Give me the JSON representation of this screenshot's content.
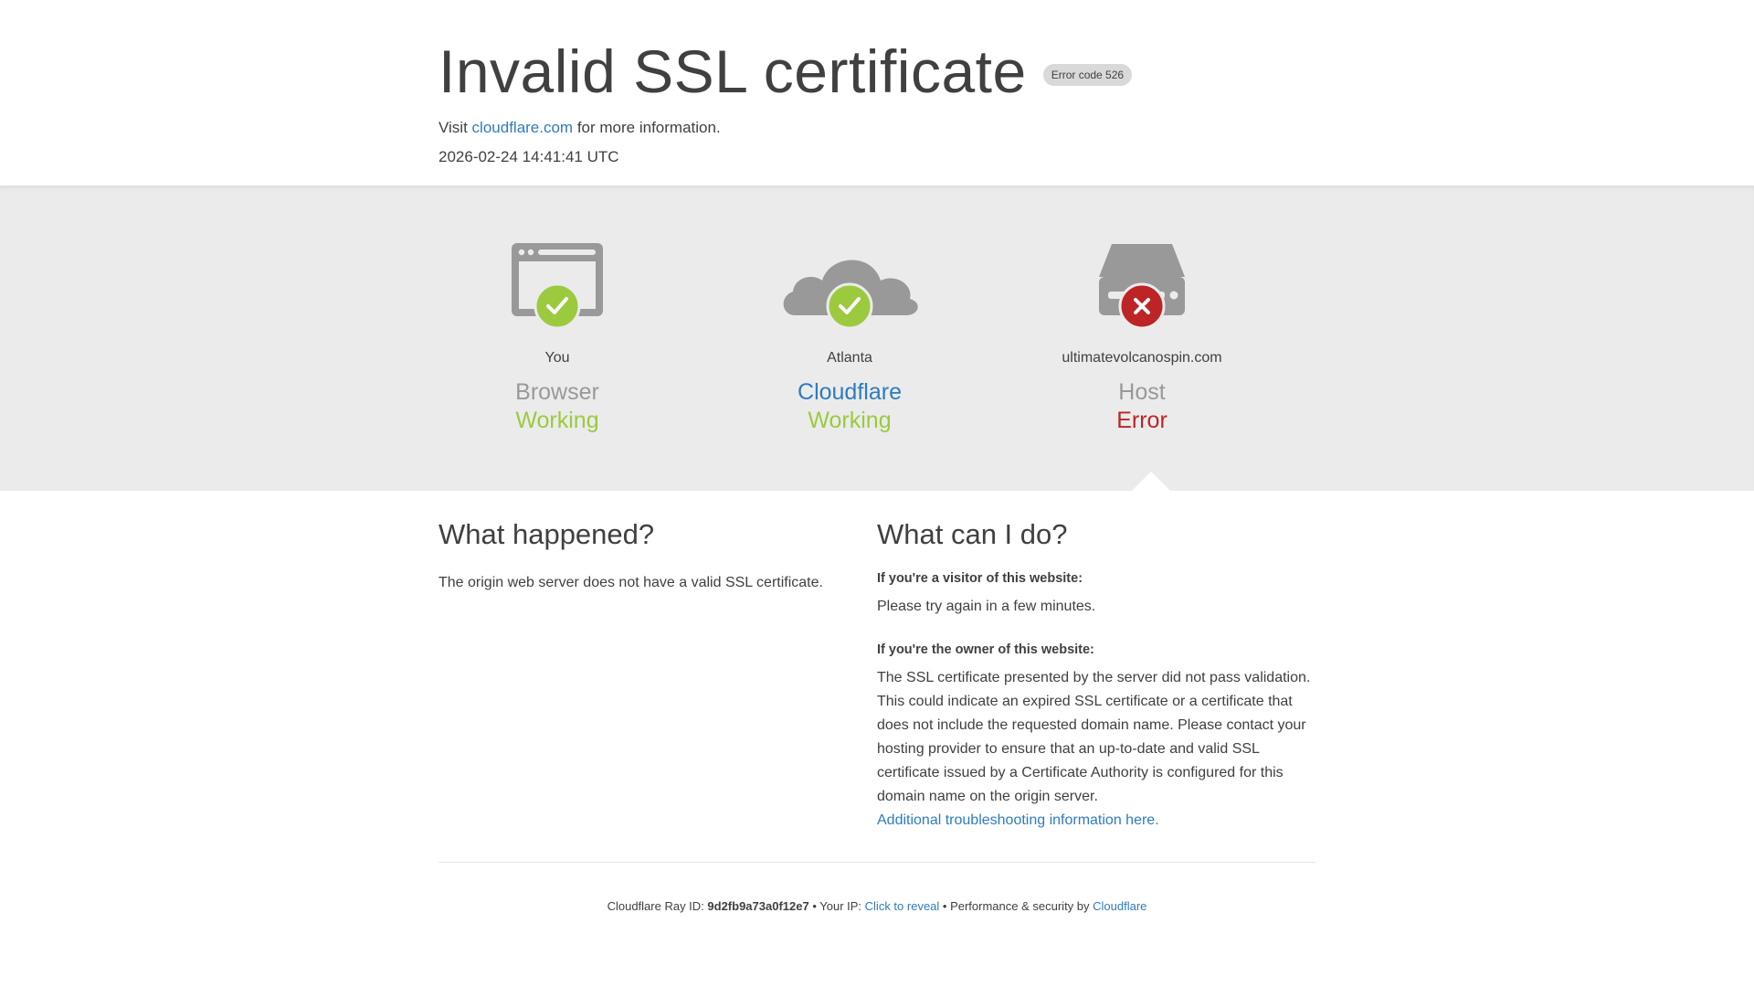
{
  "header": {
    "title": "Invalid SSL certificate",
    "error_badge": "Error code 526",
    "visit_prefix": "Visit ",
    "visit_link": "cloudflare.com",
    "visit_suffix": " for more information.",
    "timestamp": "2026-02-24 14:41:41 UTC"
  },
  "nodes": [
    {
      "location": "You",
      "name": "Browser",
      "status": "Working",
      "status_kind": "ok",
      "icon": "browser-icon"
    },
    {
      "location": "Atlanta",
      "name": "Cloudflare",
      "status": "Working",
      "status_kind": "ok",
      "icon": "cloud-icon"
    },
    {
      "location": "ultimatevolcanospin.com",
      "name": "Host",
      "status": "Error",
      "status_kind": "error",
      "icon": "server-icon"
    }
  ],
  "what_happened": {
    "heading": "What happened?",
    "text": "The origin web server does not have a valid SSL certificate."
  },
  "what_can_i_do": {
    "heading": "What can I do?",
    "visitor_label": "If you're a visitor of this website:",
    "visitor_text": "Please try again in a few minutes.",
    "owner_label": "If you're the owner of this website:",
    "owner_text": "The SSL certificate presented by the server did not pass validation. This could indicate an expired SSL certificate or a certificate that does not include the requested domain name. Please contact your hosting provider to ensure that an up-to-date and valid SSL certificate issued by a Certificate Authority is configured for this domain name on the origin server.",
    "troubleshoot_link": "Additional troubleshooting information here."
  },
  "footer": {
    "ray_label": "Cloudflare Ray ID: ",
    "ray_id": "9d2fb9a73a0f12e7",
    "sep1": " • ",
    "ip_label": "Your IP: ",
    "ip_link": "Click to reveal",
    "sep2": " • ",
    "perf_label": "Performance & security by ",
    "perf_link": "Cloudflare"
  },
  "colors": {
    "ok": "#9bca3e",
    "error": "#bd2426",
    "link": "#2f7bbf",
    "icon_gray": "#999999",
    "band_bg": "#ebebeb"
  }
}
